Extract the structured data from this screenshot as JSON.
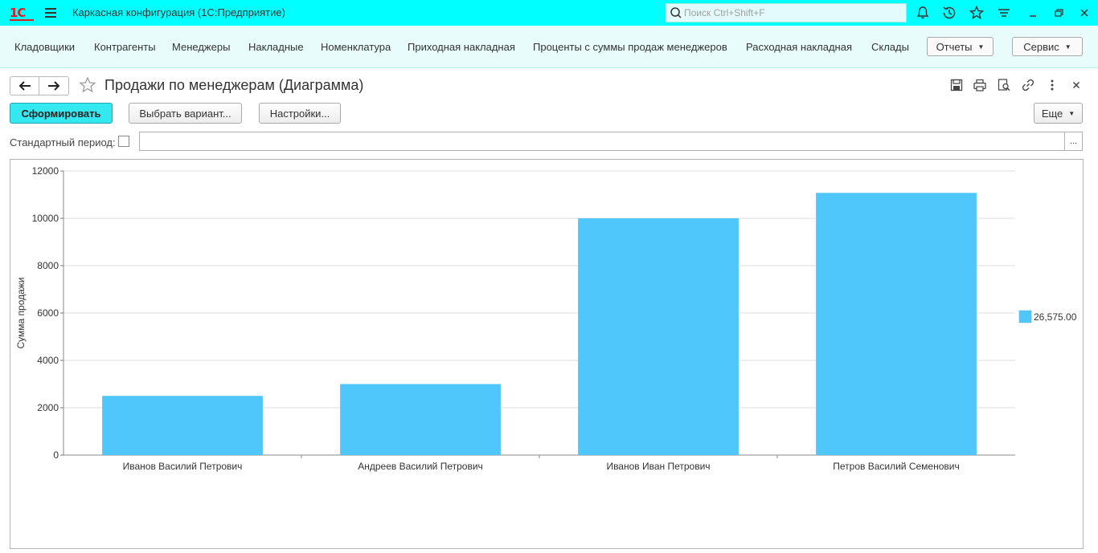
{
  "titlebar": {
    "logo": "1С",
    "app_title": "Каркасная конфигурация  (1С:Предприятие)",
    "search_placeholder": "Поиск Ctrl+Shift+F"
  },
  "nav": {
    "items": [
      "Кладовщики",
      "Контрагенты",
      "Менеджеры",
      "Накладные",
      "Номенклатура",
      "Приходная накладная",
      "Проценты с суммы продаж менеджеров",
      "Расходная накладная",
      "Склады"
    ],
    "reports_label": "Отчеты",
    "service_label": "Сервис"
  },
  "form": {
    "title": "Продажи по менеджерам (Диаграмма)"
  },
  "commands": {
    "generate_label": "Сформировать",
    "choose_variant_label": "Выбрать вариант...",
    "settings_label": "Настройки...",
    "more_label": "Еще"
  },
  "period": {
    "label": "Стандартный период:",
    "value": ""
  },
  "colors": {
    "accent": "#00ffff",
    "bar": "#4fc7fb"
  },
  "chart_data": {
    "type": "bar",
    "categories": [
      "Иванов Василий Петрович",
      "Андреев Василий Петрович",
      "Иванов Иван Петрович",
      "Петров Василий Семенович"
    ],
    "series": [
      {
        "name": "26,575.00",
        "values": [
          2500,
          3000,
          10000,
          11075
        ]
      }
    ],
    "ylabel": "Сумма продажи",
    "xlabel": "",
    "ylim": [
      0,
      12000
    ],
    "yticks": [
      "0",
      "2000",
      "4000",
      "6000",
      "8000",
      "10000",
      "12000"
    ],
    "grid": true,
    "legend_position": "right"
  }
}
